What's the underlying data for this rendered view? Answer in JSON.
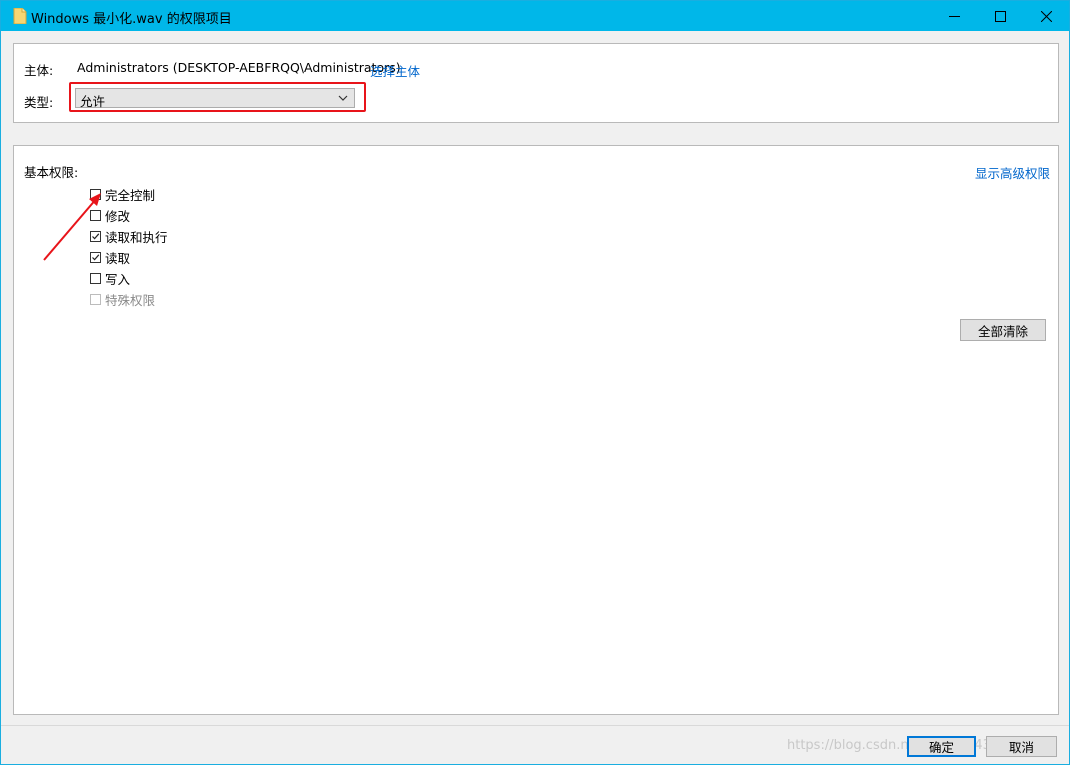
{
  "window": {
    "title": "Windows 最小化.wav 的权限项目",
    "controls": {
      "minimize": "—",
      "maximize": "☐",
      "close": "✕"
    }
  },
  "principal": {
    "label": "主体:",
    "value": "Administrators (DESKTOP-AEBFRQQ\\Administrators)",
    "select_link": "选择主体"
  },
  "type": {
    "label": "类型:",
    "selected": "允许"
  },
  "permissions": {
    "heading": "基本权限:",
    "advanced_link": "显示高级权限",
    "items": [
      {
        "label": "完全控制",
        "checked": false,
        "enabled": true
      },
      {
        "label": "修改",
        "checked": false,
        "enabled": true
      },
      {
        "label": "读取和执行",
        "checked": true,
        "enabled": true
      },
      {
        "label": "读取",
        "checked": true,
        "enabled": true
      },
      {
        "label": "写入",
        "checked": false,
        "enabled": true
      },
      {
        "label": "特殊权限",
        "checked": false,
        "enabled": false
      }
    ],
    "clear_all": "全部清除"
  },
  "footer": {
    "ok": "确定",
    "cancel": "取消",
    "watermark": "https://blog.csdn.net/weixin_43479900"
  },
  "colors": {
    "titlebar": "#00b7e9",
    "highlight": "#e8141a",
    "link": "#0066cc"
  }
}
